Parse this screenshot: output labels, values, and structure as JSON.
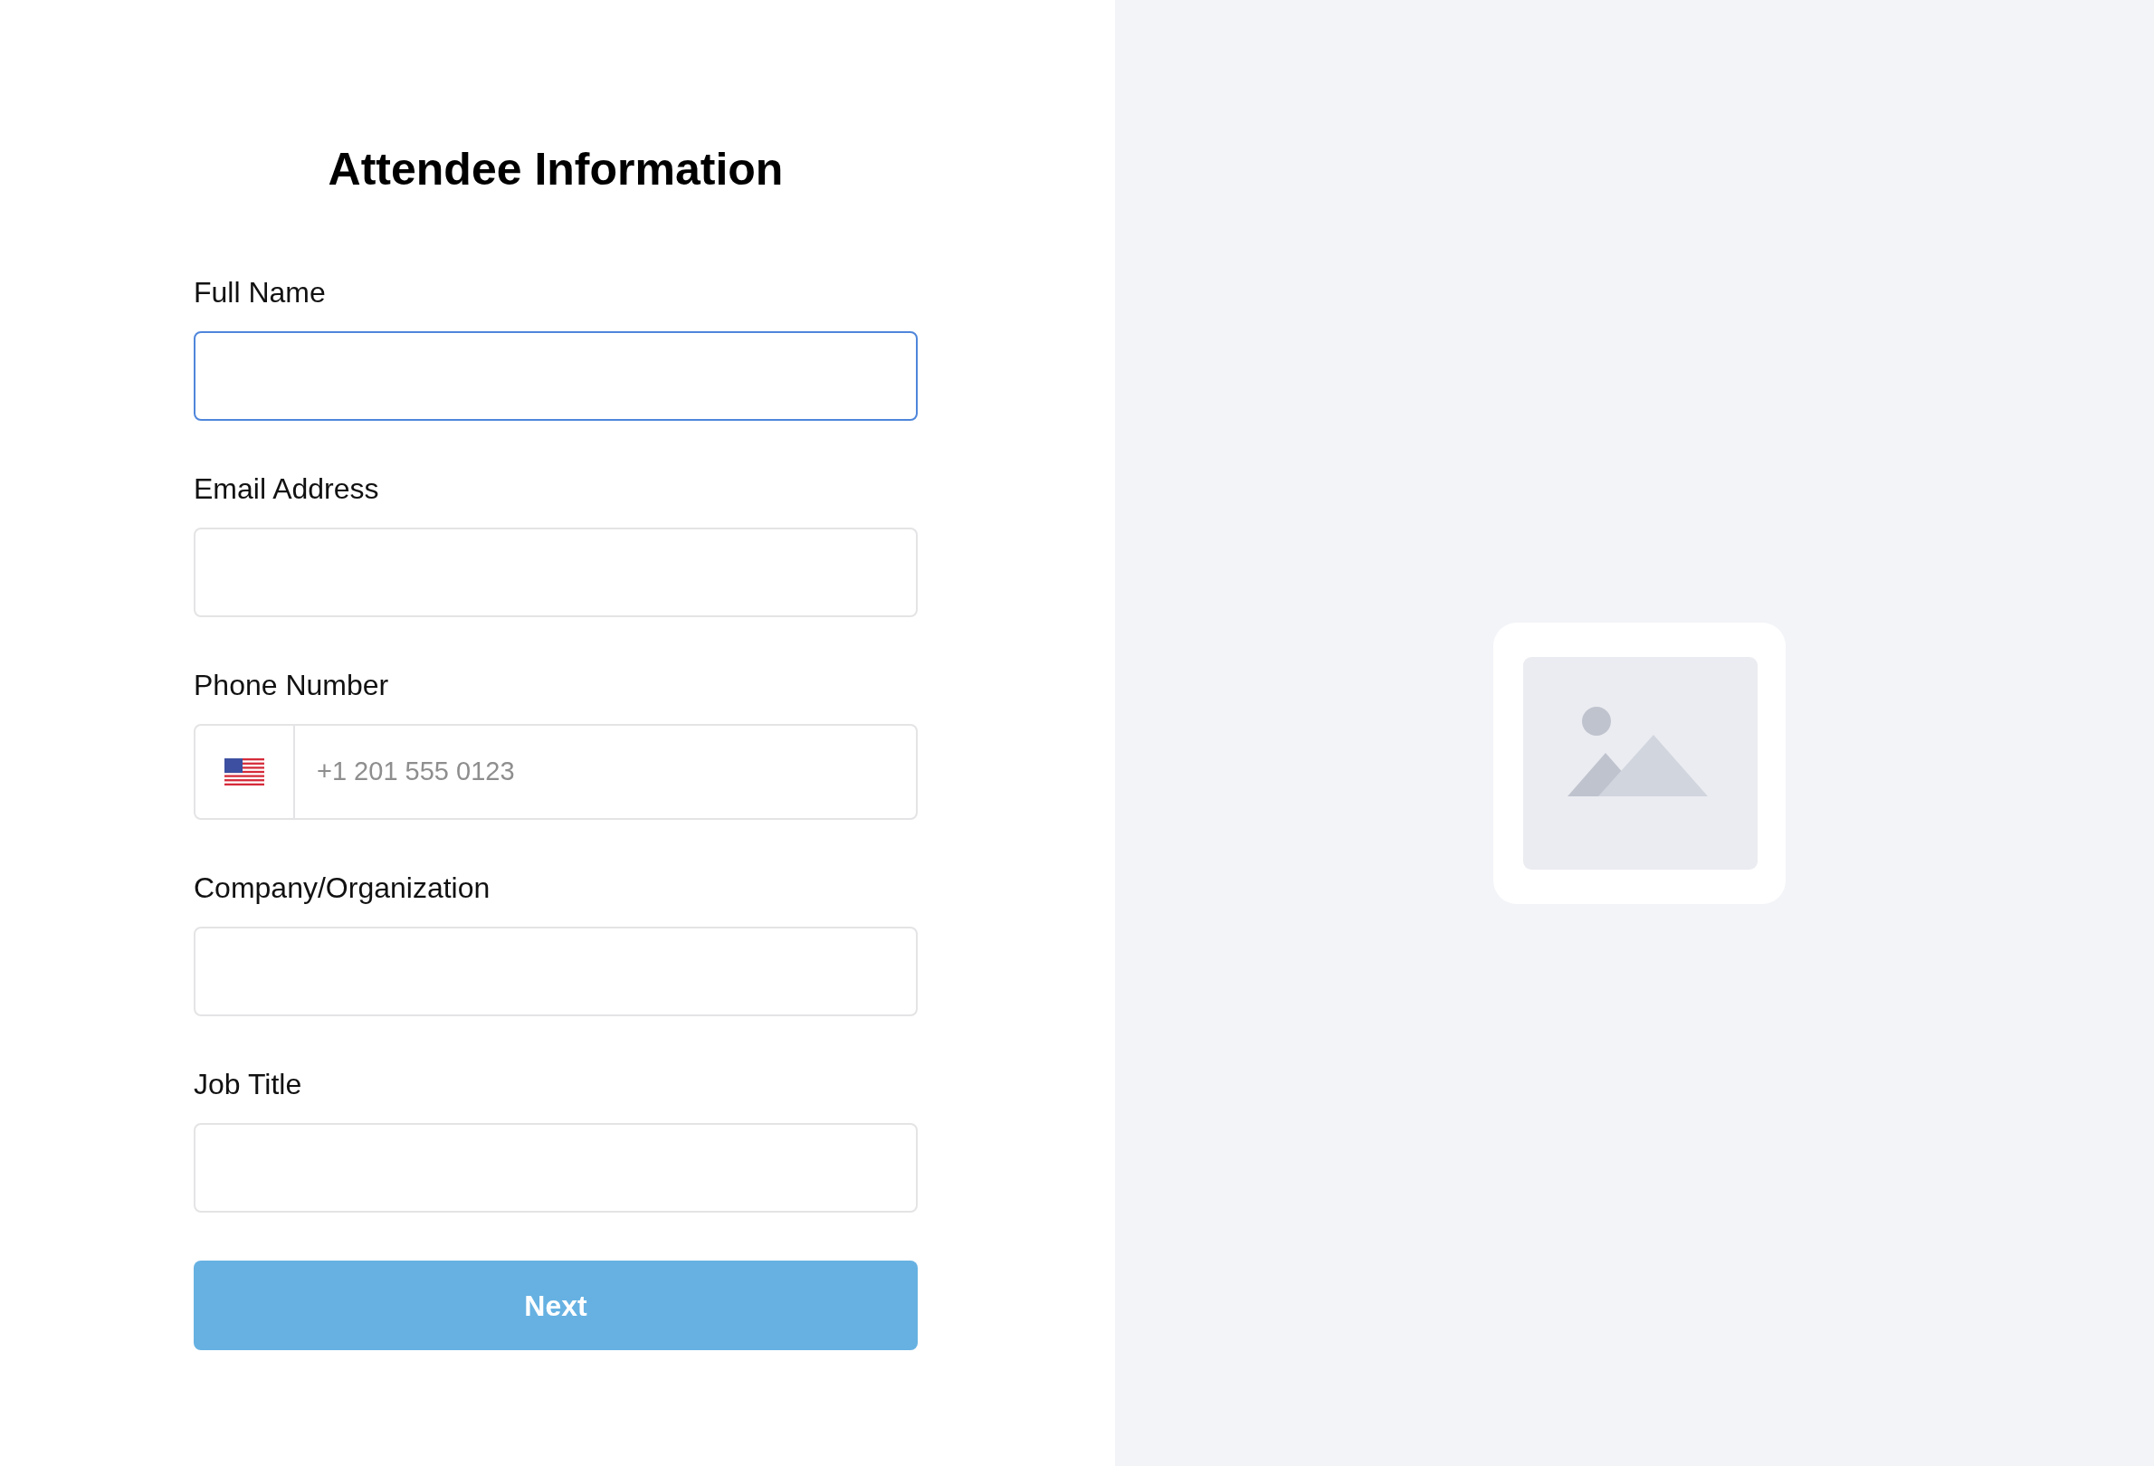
{
  "form": {
    "title": "Attendee Information",
    "fields": [
      {
        "kind": "text",
        "label": "Full Name",
        "focused": true
      },
      {
        "kind": "text",
        "label": "Email Address",
        "focused": false
      },
      {
        "kind": "phone",
        "label": "Phone Number",
        "placeholder": "+1 201 555 0123",
        "focused": false
      },
      {
        "kind": "text",
        "label": "Company/Organization",
        "focused": false
      },
      {
        "kind": "text",
        "label": "Job Title",
        "focused": false
      }
    ],
    "submit_button": {
      "label": "Next"
    }
  }
}
